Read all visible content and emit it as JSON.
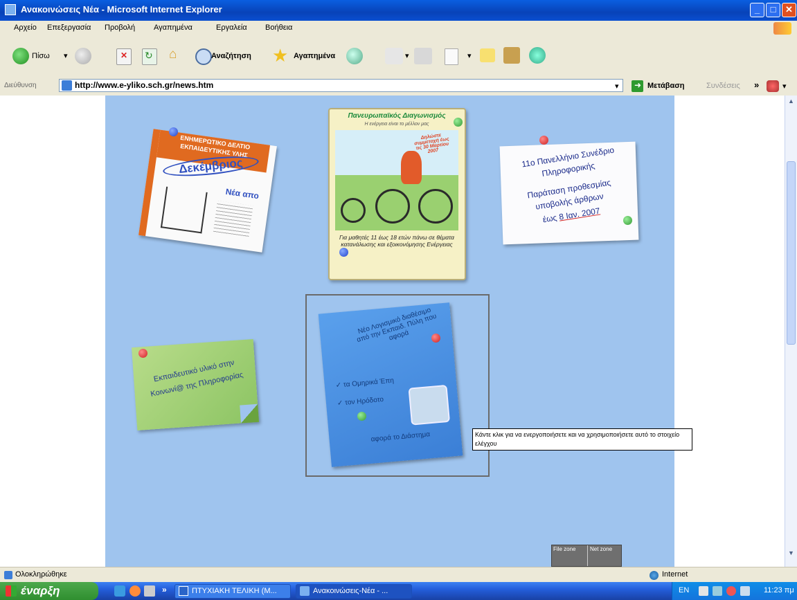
{
  "window": {
    "title": "Ανακοινώσεις Νέα - Microsoft Internet Explorer"
  },
  "menu": [
    "Αρχείο",
    "Επεξεργασία",
    "Προβολή",
    "Αγαπημένα",
    "Εργαλεία",
    "Βοήθεια"
  ],
  "toolbar": {
    "back_label": "Πίσω",
    "search_label": "Αναζήτηση",
    "favorites_label": "Αγαπημένα"
  },
  "address": {
    "label": "Διεύθυνση",
    "url": "http://www.e-yliko.sch.gr/news.htm",
    "go_label": "Μετάβαση",
    "links_label": "Συνδέσεις"
  },
  "cards": {
    "newsletter": {
      "line1": "ΕΝΗΜΕΡΩΤΙΚΟ ΔΕΛΤΙΟ",
      "line2": "ΕΚΠΑΙΔΕΥΤΙΚΗΣ ΥΛΗΣ",
      "month": "Δεκέμβριος",
      "news": "Νέα απο"
    },
    "contest": {
      "title": "Πανευρωπαϊκός Διαγωνισμός",
      "subtitle": "Η ενέργεια είναι το μέλλον μας",
      "badge": "Δηλώστε συμμετοχή έως τις 30 Μαρτίου 2007",
      "body": "Για μαθητές 11 έως 18 ετών πάνω σε θέματα κατανάλωσης και εξοικονόμησης Ενέργειας"
    },
    "conference": {
      "line1": "11ο Πανελλήνιο Συνέδριο",
      "line2": "Πληροφορικής",
      "line3": "Παράταση προθεσμίας",
      "line4": "υποβολής άρθρων",
      "line5": "έως",
      "date": "8 Ιαν. 2007"
    },
    "software": {
      "heading": "Νέο Λογισμικό διαθέσιμο από την Εκπαιδ. Πύλη που αφορά",
      "item1": "τα Ομηρικά Έπη",
      "item2": "τον Ηρόδοτο",
      "item3": "το Διάστημα",
      "item3_prefix": "αφορά"
    },
    "society": {
      "text": "Εκπαιδευτικό υλικό στην Κοινωνί@ της Πληροφορίας"
    }
  },
  "tooltip": "Κάντε κλικ για να ενεργοποιήσετε και να χρησιμοποιήσετε αυτό το στοιχείο ελέγχου",
  "zones": {
    "file": "File zone",
    "net": "Net zone"
  },
  "status": {
    "text": "Ολοκληρώθηκε",
    "zone": "Internet"
  },
  "taskbar": {
    "start": "έναρξη",
    "task1": "ΠΤΥΧΙΑΚΗ ΤΕΛΙΚΗ (Μ...",
    "task2": "Ανακοινώσεις-Νέα - ...",
    "lang": "EN",
    "clock": "11:23 πμ"
  },
  "colors": {
    "panel": "#9fc4ee",
    "titlebar": "#0842b8",
    "start": "#2f8f2f"
  }
}
